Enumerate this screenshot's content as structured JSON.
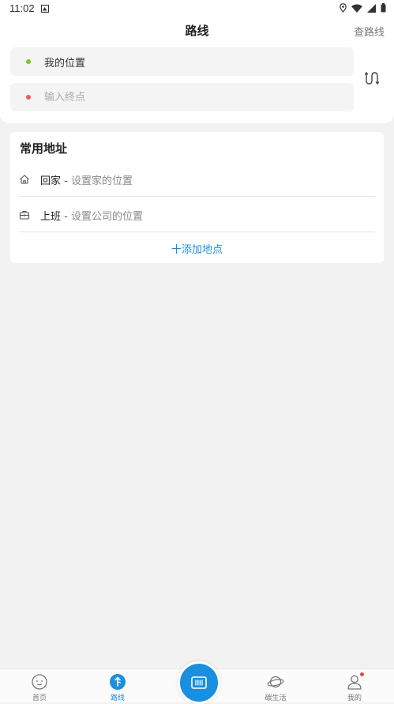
{
  "status_bar": {
    "time": "11:02"
  },
  "header": {
    "title": "路线",
    "query_route_label": "查路线"
  },
  "route_form": {
    "from_value": "我的位置",
    "to_placeholder": "输入终点",
    "from_dot_color": "#72c92b",
    "to_dot_color": "#f05b5b"
  },
  "common_addresses": {
    "title": "常用地址",
    "items": [
      {
        "name": "回家",
        "separator": " - ",
        "hint": "设置家的位置",
        "icon": "home-icon"
      },
      {
        "name": "上班",
        "separator": " - ",
        "hint": "设置公司的位置",
        "icon": "briefcase-icon"
      }
    ],
    "add_label": "十添加地点"
  },
  "tab_bar": {
    "accent_color": "#1a8fe0",
    "tabs": [
      {
        "label": "首页",
        "icon": "smile-face-icon"
      },
      {
        "label": "路线",
        "icon": "route-arrow-icon",
        "active": true
      },
      {
        "label": "碳生活",
        "icon": "planet-icon"
      },
      {
        "label": "我的",
        "icon": "user-icon"
      }
    ],
    "center_button_icon": "scan-card-icon"
  }
}
